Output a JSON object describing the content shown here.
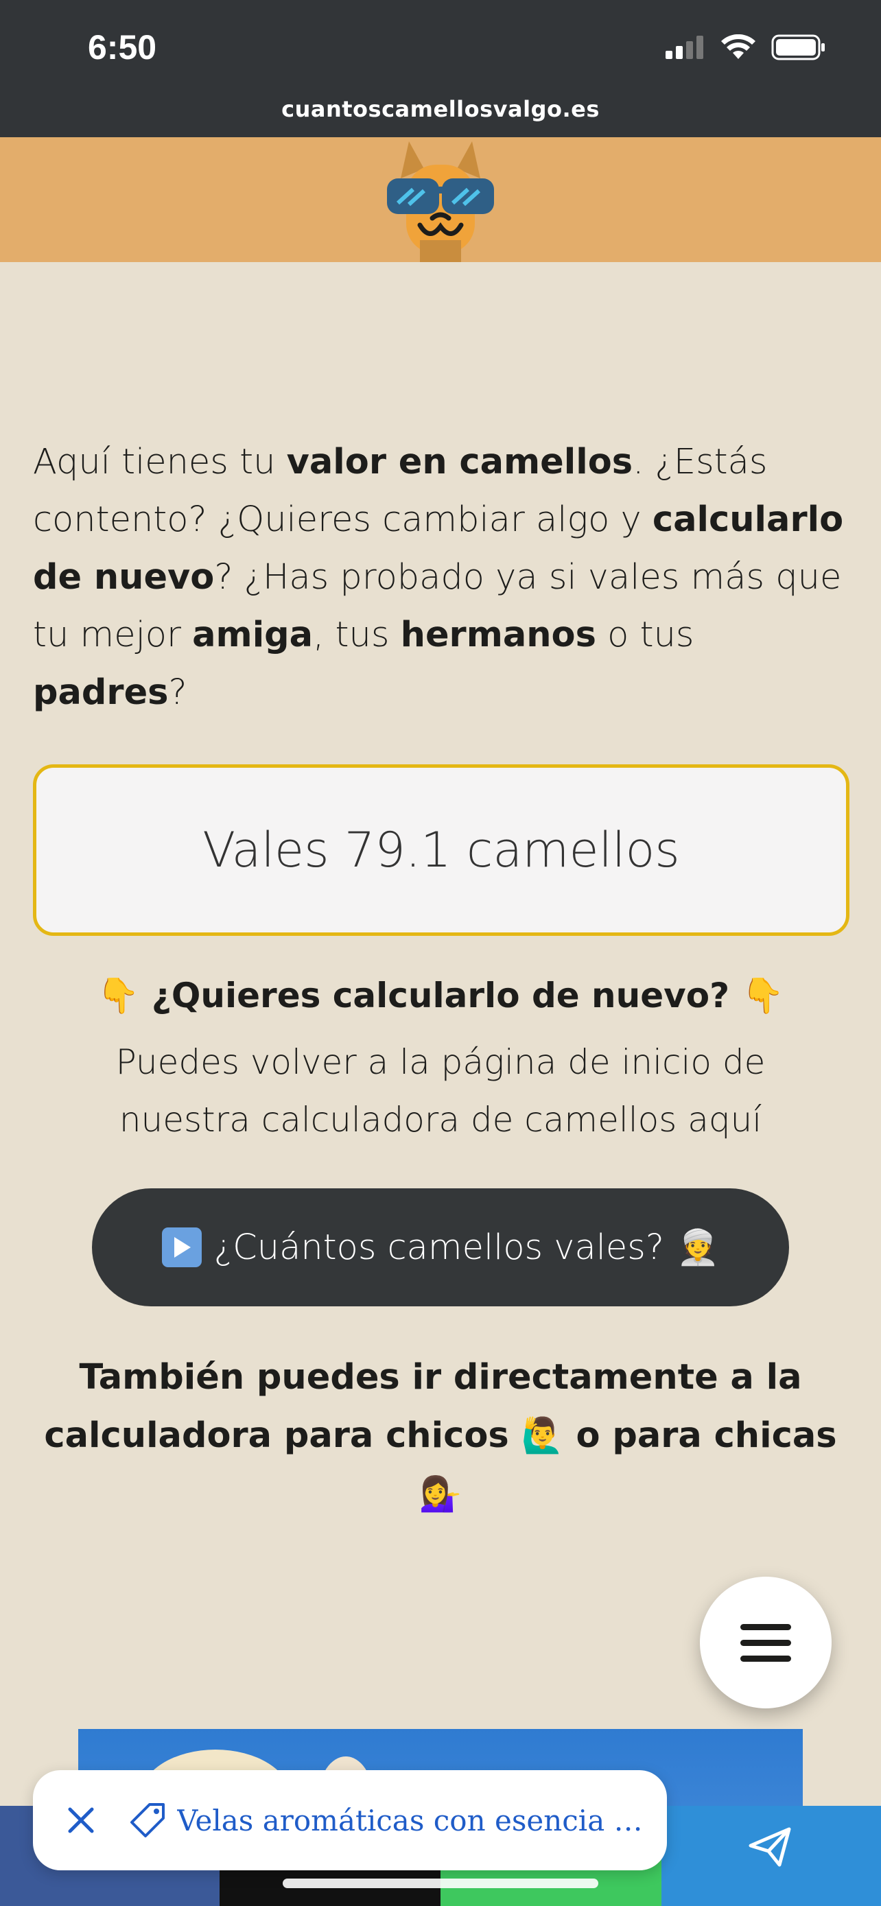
{
  "status_bar": {
    "time": "6:50",
    "url": "cuantoscamellosvalgo.es"
  },
  "intro": {
    "p1": "Aquí tienes tu ",
    "b1": "valor en camellos",
    "p2": ". ¿Estás contento? ¿Quieres cambiar algo y ",
    "b2": "calcularlo de nuevo",
    "p3": "? ¿Has probado ya si vales más que tu mejor ",
    "b3": "amiga",
    "p4": ", tus ",
    "b4": "hermanos",
    "p5": " o tus ",
    "b5": "padres",
    "p6": "?"
  },
  "result": {
    "text": "Vales 79.1 camellos"
  },
  "again": {
    "title": "¿Quieres calcularlo de nuevo?",
    "text": "Puedes volver a la página de inicio de nuestra calculadora de camellos aquí"
  },
  "cta": {
    "label": "¿Cuántos camellos vales?"
  },
  "also": {
    "part1": "También puedes ir directamente a la calculadora para chicos",
    "part2": "o para chicas"
  },
  "emojis": {
    "point_down": "👇",
    "old_man": "👳",
    "man_raising": "🙋‍♂️",
    "woman_tipping": "💁‍♀️"
  },
  "toast": {
    "text": "Velas aromáticas con esencia d…"
  },
  "colors": {
    "status_bar": "#323538",
    "header": "#e3ad6b",
    "background": "#e8e0d0",
    "accent_border": "#e4b714",
    "cta_bg": "#343739",
    "link": "#1f5cc8"
  }
}
